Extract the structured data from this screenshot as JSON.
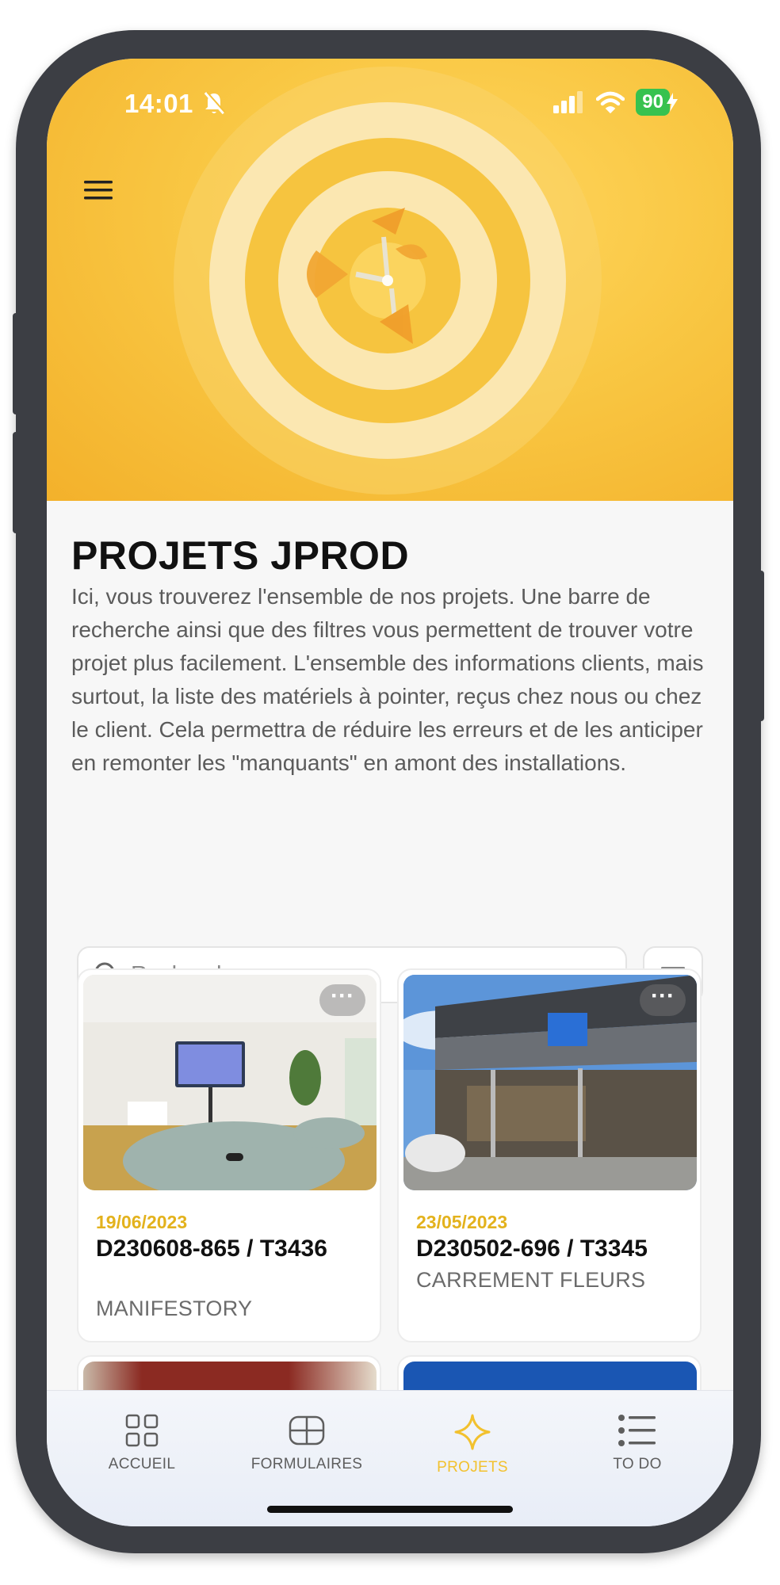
{
  "status_bar": {
    "time": "14:01",
    "battery": "90"
  },
  "header": {
    "title": "PROJETS JPROD",
    "description": "Ici, vous trouverez l'ensemble de nos projets. Une barre de recherche ainsi que des filtres vous permettent de trouver votre projet plus facilement. L'ensemble des informations clients, mais surtout, la liste des matériels à pointer, reçus chez nous ou chez le client. Cela permettra de réduire les erreurs et de les anticiper en remonter les \"manquants\" en amont des installations."
  },
  "search": {
    "placeholder": "Recherche",
    "value": ""
  },
  "projects": [
    {
      "date": "19/06/2023",
      "reference": "D230608-865 / T3436",
      "client": "MANIFESTORY",
      "menu_label": "···"
    },
    {
      "date": "23/05/2023",
      "reference": "D230502-696 / T3345",
      "client": "CARREMENT FLEURS",
      "menu_label": "···"
    }
  ],
  "tabs": [
    {
      "label": "ACCUEIL",
      "icon": "grid-icon"
    },
    {
      "label": "FORMULAIRES",
      "icon": "form-icon"
    },
    {
      "label": "PROJETS",
      "icon": "sparkle-icon",
      "active": true
    },
    {
      "label": "TO DO",
      "icon": "list-icon"
    }
  ],
  "colors": {
    "accent": "#f2c12e",
    "hero": "#f9c743",
    "battery": "#37c24f"
  }
}
